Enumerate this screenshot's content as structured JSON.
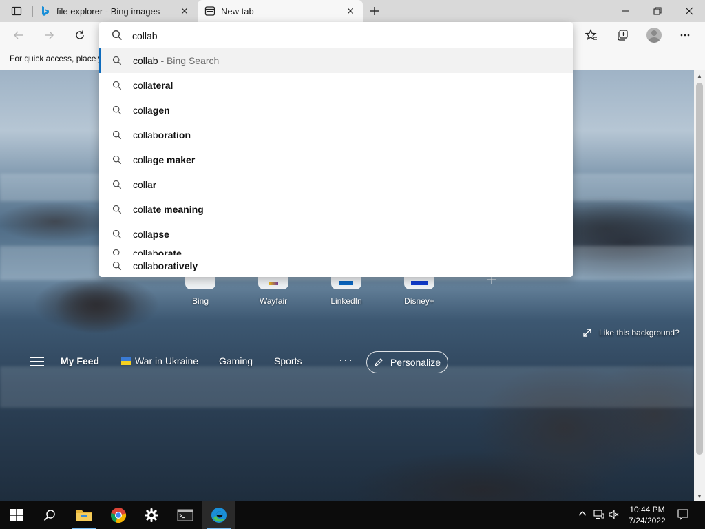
{
  "browser": {
    "tabs": [
      {
        "label": "file explorer - Bing images",
        "favicon": "bing-icon"
      },
      {
        "label": "New tab",
        "favicon": "newtab-icon"
      }
    ],
    "favorites_bar_text": "For quick access, place y"
  },
  "omnibox": {
    "typed": "collab",
    "suggestions": [
      {
        "prefix": "collab",
        "suffix": "",
        "hint": " - Bing Search"
      },
      {
        "prefix": "colla",
        "suffix": "teral",
        "hint": ""
      },
      {
        "prefix": "colla",
        "suffix": "gen",
        "hint": ""
      },
      {
        "prefix": "collab",
        "suffix": "oration",
        "hint": ""
      },
      {
        "prefix": "colla",
        "suffix": "ge maker",
        "hint": ""
      },
      {
        "prefix": "colla",
        "suffix": "r",
        "hint": ""
      },
      {
        "prefix": "colla",
        "suffix": "te meaning",
        "hint": ""
      },
      {
        "prefix": "colla",
        "suffix": "pse",
        "hint": ""
      },
      {
        "prefix": "collab",
        "suffix": "orate",
        "hint": ""
      },
      {
        "prefix": "collab",
        "suffix": "oratively",
        "hint": ""
      }
    ]
  },
  "quick_links": [
    {
      "label": "Bing",
      "color": "#0f6cbd"
    },
    {
      "label": "Wayfair",
      "color": "#7b3fa0"
    },
    {
      "label": "LinkedIn",
      "color": "#0a66c2"
    },
    {
      "label": "Disney+",
      "color": "#113ccf"
    }
  ],
  "like_background": "Like this background?",
  "feed_nav": {
    "my_feed": "My Feed",
    "war_in_ukraine": "War in Ukraine",
    "gaming": "Gaming",
    "sports": "Sports",
    "more": "···",
    "personalize": "Personalize"
  },
  "taskbar": {
    "time": "10:44 PM",
    "date": "7/24/2022"
  },
  "colors": {
    "accent": "#0f6cbd",
    "edge_blue": "#1a8fd8",
    "edge_green": "#4cc35a"
  }
}
